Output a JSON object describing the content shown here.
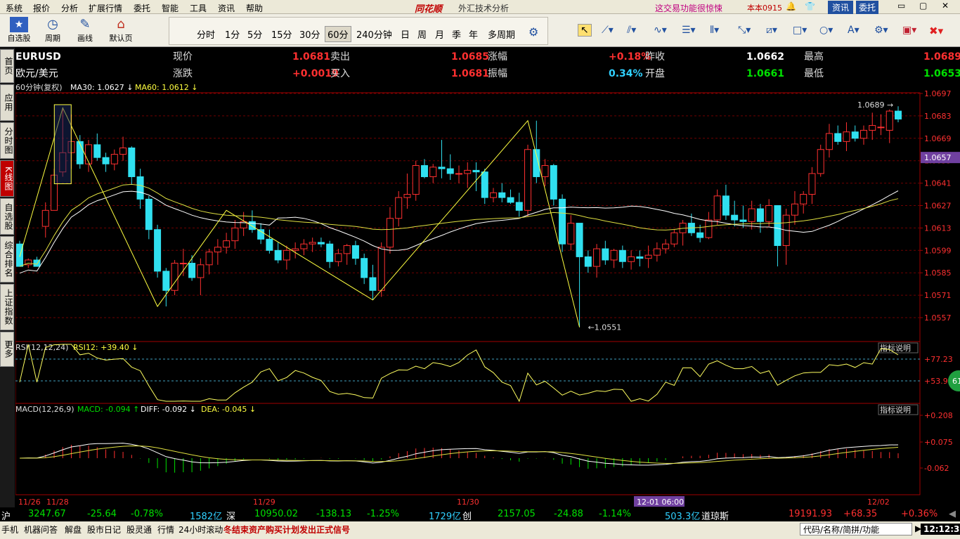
{
  "menu": [
    "系统",
    "报价",
    "分析",
    "扩展行情",
    "委托",
    "智能",
    "工具",
    "资讯",
    "帮助"
  ],
  "brand": "同花顺",
  "app_title": "外汇技术分析",
  "promo": "这交易功能很惊悚",
  "version": "本本0915",
  "topright": {
    "news": "资讯",
    "trade": "委托"
  },
  "toolbar": {
    "b1": "自选股",
    "b2": "周期",
    "b3": "画线",
    "b4": "默认页"
  },
  "periods": [
    "分时",
    "1分",
    "5分",
    "15分",
    "30分",
    "60分",
    "240分钟",
    "日",
    "周",
    "月",
    "季",
    "年",
    "多周期"
  ],
  "period_selected": "60分",
  "side_tabs": [
    "首页",
    "应用",
    "分时图",
    "K线图",
    "自选股",
    "综合排名",
    "上证指数",
    "更多"
  ],
  "quote": {
    "symbol": "EURUSD",
    "name": "欧元/美元",
    "l1": [
      "现价",
      "1.0681",
      "卖出",
      "1.0685",
      "涨幅",
      "+0.18%",
      "昨收",
      "1.0662",
      "最高",
      "1.0689"
    ],
    "l2": [
      "涨跌",
      "+0.0019",
      "买入",
      "1.0681",
      "振幅",
      "0.34%",
      "开盘",
      "1.0661",
      "最低",
      "1.0653"
    ]
  },
  "ma_line": {
    "period": "60分钟(复权)",
    "ma30": "MA30: 1.0627",
    "ma60": "MA60: 1.0612"
  },
  "rsi_line": {
    "label": "RSI(12,12,24)",
    "rsi": "RSI12: +39.40"
  },
  "macd_line": {
    "label": "MACD(12,26,9)",
    "macd": "MACD: -0.094",
    "diff": "DIFF: -0.092",
    "dea": "DEA: -0.045"
  },
  "indicator_help": "指标说明",
  "price_axis": [
    "1.0697",
    "1.0683",
    "1.0669",
    "1.0655",
    "1.0641",
    "1.0627",
    "1.0613",
    "1.0599",
    "1.0585",
    "1.0571",
    "1.0557"
  ],
  "price_current": "1.0657",
  "rsi_axis": [
    "+77.23",
    "+53.95"
  ],
  "macd_axis": [
    "+0.208",
    "+0.075",
    "-0.062"
  ],
  "date_axis": [
    "11/26",
    "11/28",
    "11/29",
    "11/30",
    "12-01 06:00",
    "12/02"
  ],
  "annot_high": "1.0689",
  "annot_low": "1.0551",
  "badge": "61",
  "chart_data": {
    "type": "candlestick",
    "ohlc": [
      [
        1.0603,
        1.0605,
        1.0589,
        1.0589
      ],
      [
        1.059,
        1.0594,
        1.0588,
        1.0593
      ],
      [
        1.0593,
        1.0595,
        1.0589,
        1.0589
      ],
      [
        1.0614,
        1.0629,
        1.0607,
        1.0624
      ],
      [
        1.0624,
        1.065,
        1.0624,
        1.0646
      ],
      [
        1.0648,
        1.0688,
        1.0645,
        1.066
      ],
      [
        1.066,
        1.0684,
        1.065,
        1.0667
      ],
      [
        1.0667,
        1.0671,
        1.065,
        1.0653
      ],
      [
        1.0653,
        1.0668,
        1.0648,
        1.0665
      ],
      [
        1.0665,
        1.0672,
        1.0655,
        1.0657
      ],
      [
        1.0657,
        1.066,
        1.0648,
        1.0653
      ],
      [
        1.0653,
        1.0662,
        1.0649,
        1.0659
      ],
      [
        1.0659,
        1.067,
        1.0655,
        1.0663
      ],
      [
        1.0663,
        1.0664,
        1.064,
        1.0645
      ],
      [
        1.0645,
        1.065,
        1.0625,
        1.0631
      ],
      [
        1.0631,
        1.0633,
        1.0606,
        1.0612
      ],
      [
        1.0612,
        1.0615,
        1.0582,
        1.0586
      ],
      [
        1.0586,
        1.0588,
        1.0564,
        1.0574
      ],
      [
        1.0574,
        1.0593,
        1.0571,
        1.0591
      ],
      [
        1.0591,
        1.06,
        1.0583,
        1.0591
      ],
      [
        1.0591,
        1.0596,
        1.058,
        1.0582
      ],
      [
        1.0582,
        1.0594,
        1.0571,
        1.059
      ],
      [
        1.059,
        1.06,
        1.0584,
        1.0598
      ],
      [
        1.0598,
        1.0606,
        1.059,
        1.0601
      ],
      [
        1.0601,
        1.061,
        1.0597,
        1.0605
      ],
      [
        1.0605,
        1.0618,
        1.06,
        1.0613
      ],
      [
        1.0613,
        1.0623,
        1.0608,
        1.0617
      ],
      [
        1.0617,
        1.0624,
        1.061,
        1.0612
      ],
      [
        1.0612,
        1.0616,
        1.0603,
        1.0606
      ],
      [
        1.0606,
        1.0612,
        1.0597,
        1.0599
      ],
      [
        1.0599,
        1.0604,
        1.0591,
        1.0593
      ],
      [
        1.0593,
        1.0602,
        1.0587,
        1.0599
      ],
      [
        1.0599,
        1.0604,
        1.0594,
        1.06
      ],
      [
        1.06,
        1.0606,
        1.0596,
        1.0603
      ],
      [
        1.0603,
        1.0607,
        1.0598,
        1.0604
      ],
      [
        1.0604,
        1.0607,
        1.0601,
        1.0603
      ],
      [
        1.0603,
        1.0605,
        1.0588,
        1.0592
      ],
      [
        1.0592,
        1.06,
        1.0589,
        1.0597
      ],
      [
        1.0597,
        1.0603,
        1.059,
        1.0602
      ],
      [
        1.0602,
        1.0605,
        1.059,
        1.0594
      ],
      [
        1.0594,
        1.0597,
        1.0578,
        1.0582
      ],
      [
        1.0582,
        1.059,
        1.0568,
        1.0574
      ],
      [
        1.0574,
        1.0604,
        1.057,
        1.0601
      ],
      [
        1.0601,
        1.0626,
        1.0597,
        1.0619
      ],
      [
        1.0619,
        1.0636,
        1.0614,
        1.0632
      ],
      [
        1.0632,
        1.0647,
        1.0625,
        1.0634
      ],
      [
        1.0634,
        1.0655,
        1.063,
        1.0652
      ],
      [
        1.0652,
        1.0656,
        1.0644,
        1.0645
      ],
      [
        1.0645,
        1.0653,
        1.0641,
        1.0651
      ],
      [
        1.0651,
        1.0668,
        1.0644,
        1.065
      ],
      [
        1.065,
        1.0659,
        1.0643,
        1.0647
      ],
      [
        1.0647,
        1.0652,
        1.0641,
        1.0647
      ],
      [
        1.0647,
        1.0654,
        1.0638,
        1.0649
      ],
      [
        1.0649,
        1.0654,
        1.0636,
        1.0648
      ],
      [
        1.0648,
        1.065,
        1.0628,
        1.0632
      ],
      [
        1.0632,
        1.0638,
        1.0629,
        1.0635
      ],
      [
        1.0635,
        1.0641,
        1.0629,
        1.0632
      ],
      [
        1.0632,
        1.0637,
        1.0628,
        1.0629
      ],
      [
        1.0629,
        1.0635,
        1.062,
        1.0624
      ],
      [
        1.0624,
        1.0665,
        1.062,
        1.0662
      ],
      [
        1.0662,
        1.068,
        1.0641,
        1.0645
      ],
      [
        1.0645,
        1.0656,
        1.0639,
        1.0652
      ],
      [
        1.0652,
        1.0653,
        1.0627,
        1.0631
      ],
      [
        1.0631,
        1.0634,
        1.0598,
        1.0603
      ],
      [
        1.0603,
        1.0621,
        1.0599,
        1.0616
      ],
      [
        1.0616,
        1.0616,
        1.0551,
        1.0595
      ],
      [
        1.0595,
        1.0599,
        1.0585,
        1.0589
      ],
      [
        1.0589,
        1.0603,
        1.0582,
        1.06
      ],
      [
        1.06,
        1.0605,
        1.059,
        1.0593
      ],
      [
        1.0593,
        1.06,
        1.0588,
        1.0599
      ],
      [
        1.0599,
        1.0602,
        1.0588,
        1.0592
      ],
      [
        1.0592,
        1.0599,
        1.0587,
        1.0595
      ],
      [
        1.0595,
        1.0599,
        1.0589,
        1.0594
      ],
      [
        1.0594,
        1.0602,
        1.0588,
        1.0596
      ],
      [
        1.0596,
        1.0604,
        1.0592,
        1.06
      ],
      [
        1.06,
        1.0606,
        1.0597,
        1.0603
      ],
      [
        1.0603,
        1.0612,
        1.0601,
        1.061
      ],
      [
        1.061,
        1.0618,
        1.0602,
        1.0616
      ],
      [
        1.0616,
        1.0622,
        1.0608,
        1.061
      ],
      [
        1.061,
        1.0615,
        1.0604,
        1.0607
      ],
      [
        1.0607,
        1.0623,
        1.0606,
        1.0618
      ],
      [
        1.0618,
        1.0637,
        1.0615,
        1.0633
      ],
      [
        1.0633,
        1.064,
        1.0618,
        1.0621
      ],
      [
        1.0621,
        1.063,
        1.0614,
        1.0618
      ],
      [
        1.0618,
        1.0627,
        1.0613,
        1.0617
      ],
      [
        1.0617,
        1.063,
        1.0612,
        1.0625
      ],
      [
        1.0625,
        1.0628,
        1.061,
        1.0617
      ],
      [
        1.0617,
        1.0631,
        1.0614,
        1.0627
      ],
      [
        1.0627,
        1.0627,
        1.0589,
        1.0602
      ],
      [
        1.0602,
        1.0625,
        1.059,
        1.0621
      ],
      [
        1.0621,
        1.0636,
        1.0615,
        1.0628
      ],
      [
        1.0628,
        1.0636,
        1.0622,
        1.0634
      ],
      [
        1.0634,
        1.0651,
        1.0628,
        1.0647
      ],
      [
        1.0647,
        1.0665,
        1.0645,
        1.0662
      ],
      [
        1.0662,
        1.0678,
        1.0657,
        1.0672
      ],
      [
        1.0672,
        1.0677,
        1.0665,
        1.0667
      ],
      [
        1.0667,
        1.0679,
        1.0661,
        1.0673
      ],
      [
        1.0673,
        1.0677,
        1.0667,
        1.0669
      ],
      [
        1.0669,
        1.0677,
        1.0665,
        1.0674
      ],
      [
        1.0674,
        1.0685,
        1.0668,
        1.0677
      ],
      [
        1.0676,
        1.0684,
        1.0671,
        1.0676
      ],
      [
        1.0674,
        1.0687,
        1.0666,
        1.0686
      ],
      [
        1.0686,
        1.0689,
        1.0679,
        1.0681
      ]
    ]
  }
}
